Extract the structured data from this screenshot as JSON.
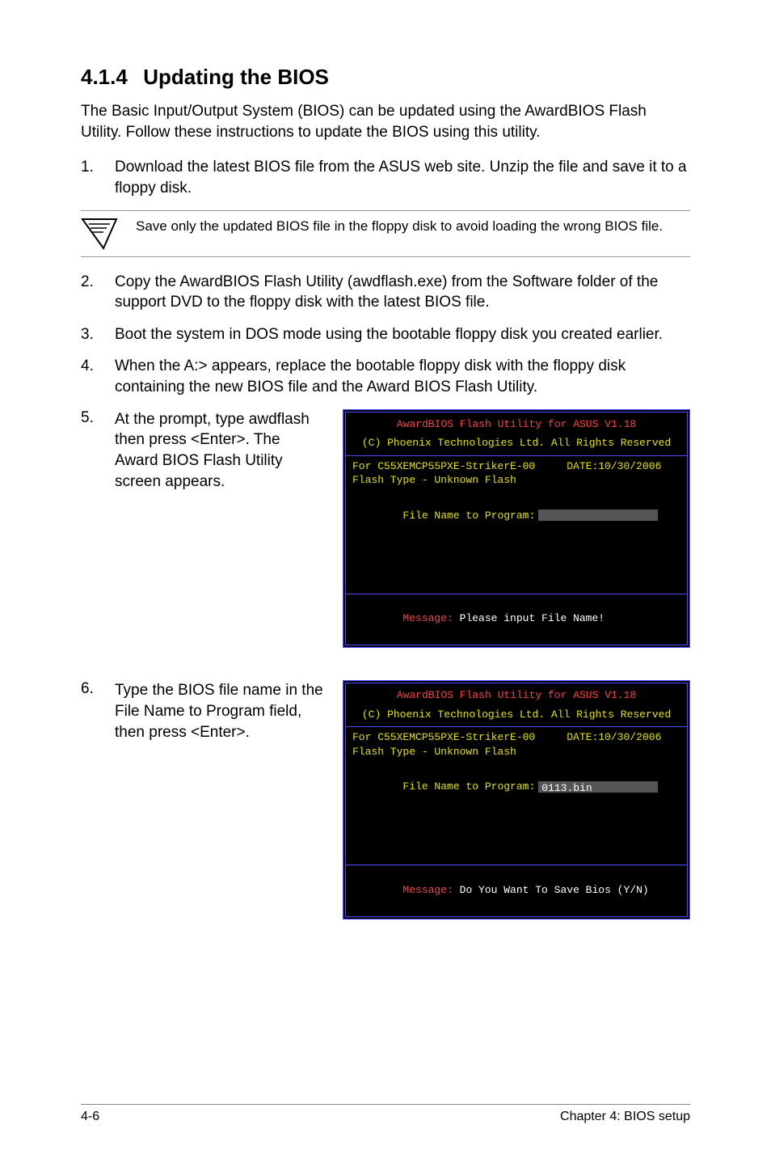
{
  "heading": {
    "number": "4.1.4",
    "title": "Updating the BIOS"
  },
  "intro": "The Basic Input/Output System (BIOS) can be updated using the AwardBIOS Flash Utility. Follow these instructions to update the BIOS using this utility.",
  "steps": {
    "s1": {
      "num": "1.",
      "text": "Download the latest BIOS file from the ASUS web site. Unzip the file and save it to a floppy disk."
    },
    "note": "Save only the updated BIOS file in the floppy disk to avoid loading the wrong BIOS file.",
    "s2": {
      "num": "2.",
      "text": "Copy the AwardBIOS Flash Utility (awdflash.exe) from the Software folder of the support DVD to the floppy disk with the latest BIOS file."
    },
    "s3": {
      "num": "3.",
      "text": "Boot the system in DOS mode using the bootable floppy disk you created earlier."
    },
    "s4": {
      "num": "4.",
      "text": "When the A:> appears, replace the bootable floppy disk with the floppy disk containing the new BIOS file and the Award BIOS Flash Utility."
    },
    "s5": {
      "num": "5.",
      "text": "At the prompt, type awdflash then press <Enter>. The Award BIOS Flash Utility screen appears."
    },
    "s6": {
      "num": "6.",
      "text": "Type the BIOS file name in the File Name to Program field, then press <Enter>."
    }
  },
  "terminal1": {
    "title": "AwardBIOS Flash Utility for ASUS V1.18",
    "copyright": "(C) Phoenix Technologies Ltd. All Rights Reserved",
    "infoLine1": "For C55XEMCP55PXE-StrikerE-00     DATE:10/30/2006",
    "infoLine2": "Flash Type - Unknown Flash",
    "promptLabel": "File Name to Program:",
    "inputValue": "",
    "messageLabel": "Message:",
    "messageText": " Please input File Name!"
  },
  "terminal2": {
    "title": "AwardBIOS Flash Utility for ASUS V1.18",
    "copyright": "(C) Phoenix Technologies Ltd. All Rights Reserved",
    "infoLine1": "For C55XEMCP55PXE-StrikerE-00     DATE:10/30/2006",
    "infoLine2": "Flash Type - Unknown Flash",
    "promptLabel": "File Name to Program:",
    "inputValue": "0113.bin",
    "messageLabel": "Message:",
    "messageText": " Do You Want To Save Bios (Y/N)"
  },
  "footer": {
    "left": "4-6",
    "right": "Chapter 4: BIOS setup"
  }
}
